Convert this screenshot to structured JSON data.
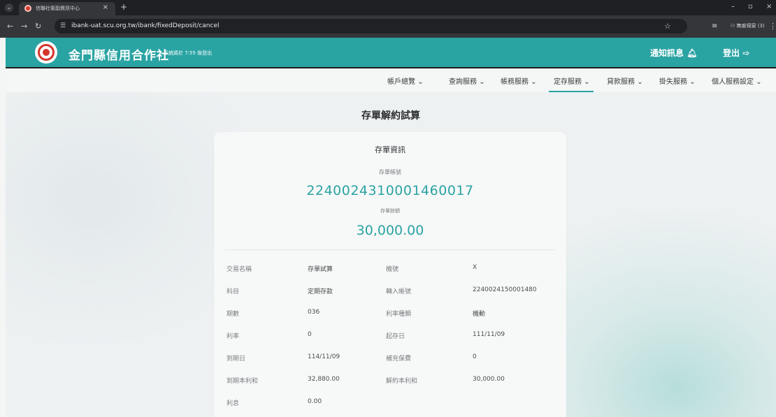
{
  "browser": {
    "tab_title": "信聯社衛副資訊中心",
    "url": "ibank-uat.scu.org.tw/ibank/fixedDeposit/cancel",
    "profile_label": "無痕視窗 (3)"
  },
  "header": {
    "brand": "金門縣信用合作社",
    "session": "系統將於 7:55 後登出",
    "notify_label": "通知訊息",
    "logout_label": "登出"
  },
  "menu": {
    "items": [
      {
        "label": "帳戶總覽"
      },
      {
        "label": "查詢服務"
      },
      {
        "label": "帳務服務"
      },
      {
        "label": "定存服務"
      },
      {
        "label": "貸款服務"
      },
      {
        "label": "掛失服務"
      },
      {
        "label": "個人服務設定"
      }
    ],
    "active": "定存服務"
  },
  "page": {
    "title": "存單解約試算"
  },
  "card": {
    "title": "存單資訊",
    "account_label": "存單帳號",
    "account_number": "2240024310001460017",
    "balance_label": "存單餘額",
    "balance": "30,000.00"
  },
  "details": [
    {
      "l1": "交易名稱",
      "v1": "存單試算",
      "l2": "機號",
      "v2": "X"
    },
    {
      "l1": "科目",
      "v1": "定期存款",
      "l2": "轉入帳號",
      "v2": "2240024150001480"
    },
    {
      "l1": "期數",
      "v1": "036",
      "l2": "利率種類",
      "v2": "機動"
    },
    {
      "l1": "利率",
      "v1": "0",
      "l2": "起存日",
      "v2": "111/11/09"
    },
    {
      "l1": "到期日",
      "v1": "114/11/09",
      "l2": "補充保費",
      "v2": "0"
    },
    {
      "l1": "到期本利和",
      "v1": "32,880.00",
      "l2": "解約本利和",
      "v2": "30,000.00"
    },
    {
      "l1": "利息",
      "v1": "0.00",
      "l2": "",
      "v2": ""
    }
  ],
  "colors": {
    "accent": "#2aa3a3",
    "brand_red": "#d3362a"
  }
}
